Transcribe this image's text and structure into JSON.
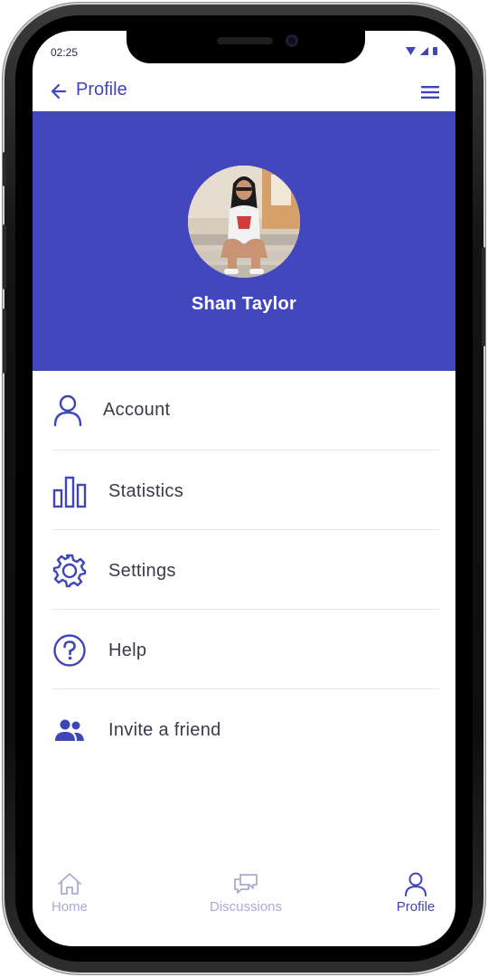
{
  "status_bar": {
    "time": "02:25"
  },
  "app_bar": {
    "title": "Profile"
  },
  "profile": {
    "name": "Shan Taylor"
  },
  "menu": {
    "items": [
      {
        "label": "Account",
        "icon": "user-icon"
      },
      {
        "label": "Statistics",
        "icon": "bar-chart-icon"
      },
      {
        "label": "Settings",
        "icon": "gear-icon"
      },
      {
        "label": "Help",
        "icon": "help-icon"
      },
      {
        "label": "Invite a friend",
        "icon": "people-icon"
      }
    ]
  },
  "bottom_nav": {
    "items": [
      {
        "label": "Home",
        "icon": "home-icon",
        "active": false
      },
      {
        "label": "Discussions",
        "icon": "chat-icon",
        "active": false
      },
      {
        "label": "Profile",
        "icon": "user-icon",
        "active": true
      }
    ]
  },
  "colors": {
    "primary": "#4247bd",
    "nav_inactive": "#a8abd8",
    "text": "#3a3a4a"
  }
}
